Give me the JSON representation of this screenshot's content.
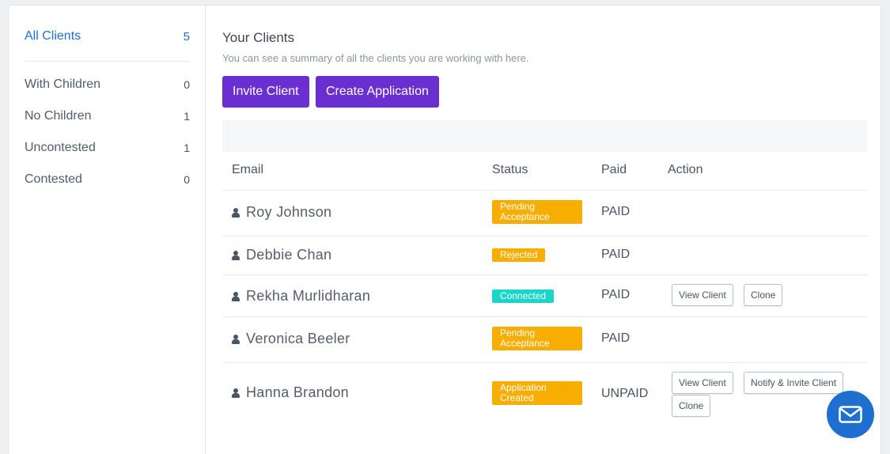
{
  "sidebar": {
    "items": [
      {
        "label": "All Clients",
        "count": "5"
      },
      {
        "label": "With Children",
        "count": "0"
      },
      {
        "label": "No Children",
        "count": "1"
      },
      {
        "label": "Uncontested",
        "count": "1"
      },
      {
        "label": "Contested",
        "count": "0"
      }
    ]
  },
  "main": {
    "title": "Your Clients",
    "subtitle": "You can see a summary of all the clients you are working with here.",
    "invite_label": "Invite Client",
    "create_label": "Create Application"
  },
  "table": {
    "headers": {
      "email": "Email",
      "status": "Status",
      "paid": "Paid",
      "action": "Action"
    },
    "rows": [
      {
        "name": "Roy Johnson",
        "status": "Pending Acceptance",
        "paid": "PAID"
      },
      {
        "name": "Debbie Chan",
        "status": "Rejected",
        "paid": "PAID"
      },
      {
        "name": "Rekha Murlidharan",
        "status": "Connected",
        "paid": "PAID",
        "actions": [
          "View Client",
          "Clone"
        ]
      },
      {
        "name": "Veronica Beeler",
        "status": "Pending Acceptance",
        "paid": "PAID"
      },
      {
        "name": "Hanna Brandon",
        "status": "Application Created",
        "paid": "UNPAID",
        "actions": [
          "View Client",
          "Notify & Invite Client",
          "Clone"
        ]
      }
    ]
  },
  "colors": {
    "accent_purple": "#6a2fd0",
    "link_blue": "#1f6fd1",
    "badge_orange": "#f8ae00",
    "badge_teal": "#19d6c8"
  },
  "icons": {
    "user": "user-icon",
    "message": "envelope-icon"
  }
}
